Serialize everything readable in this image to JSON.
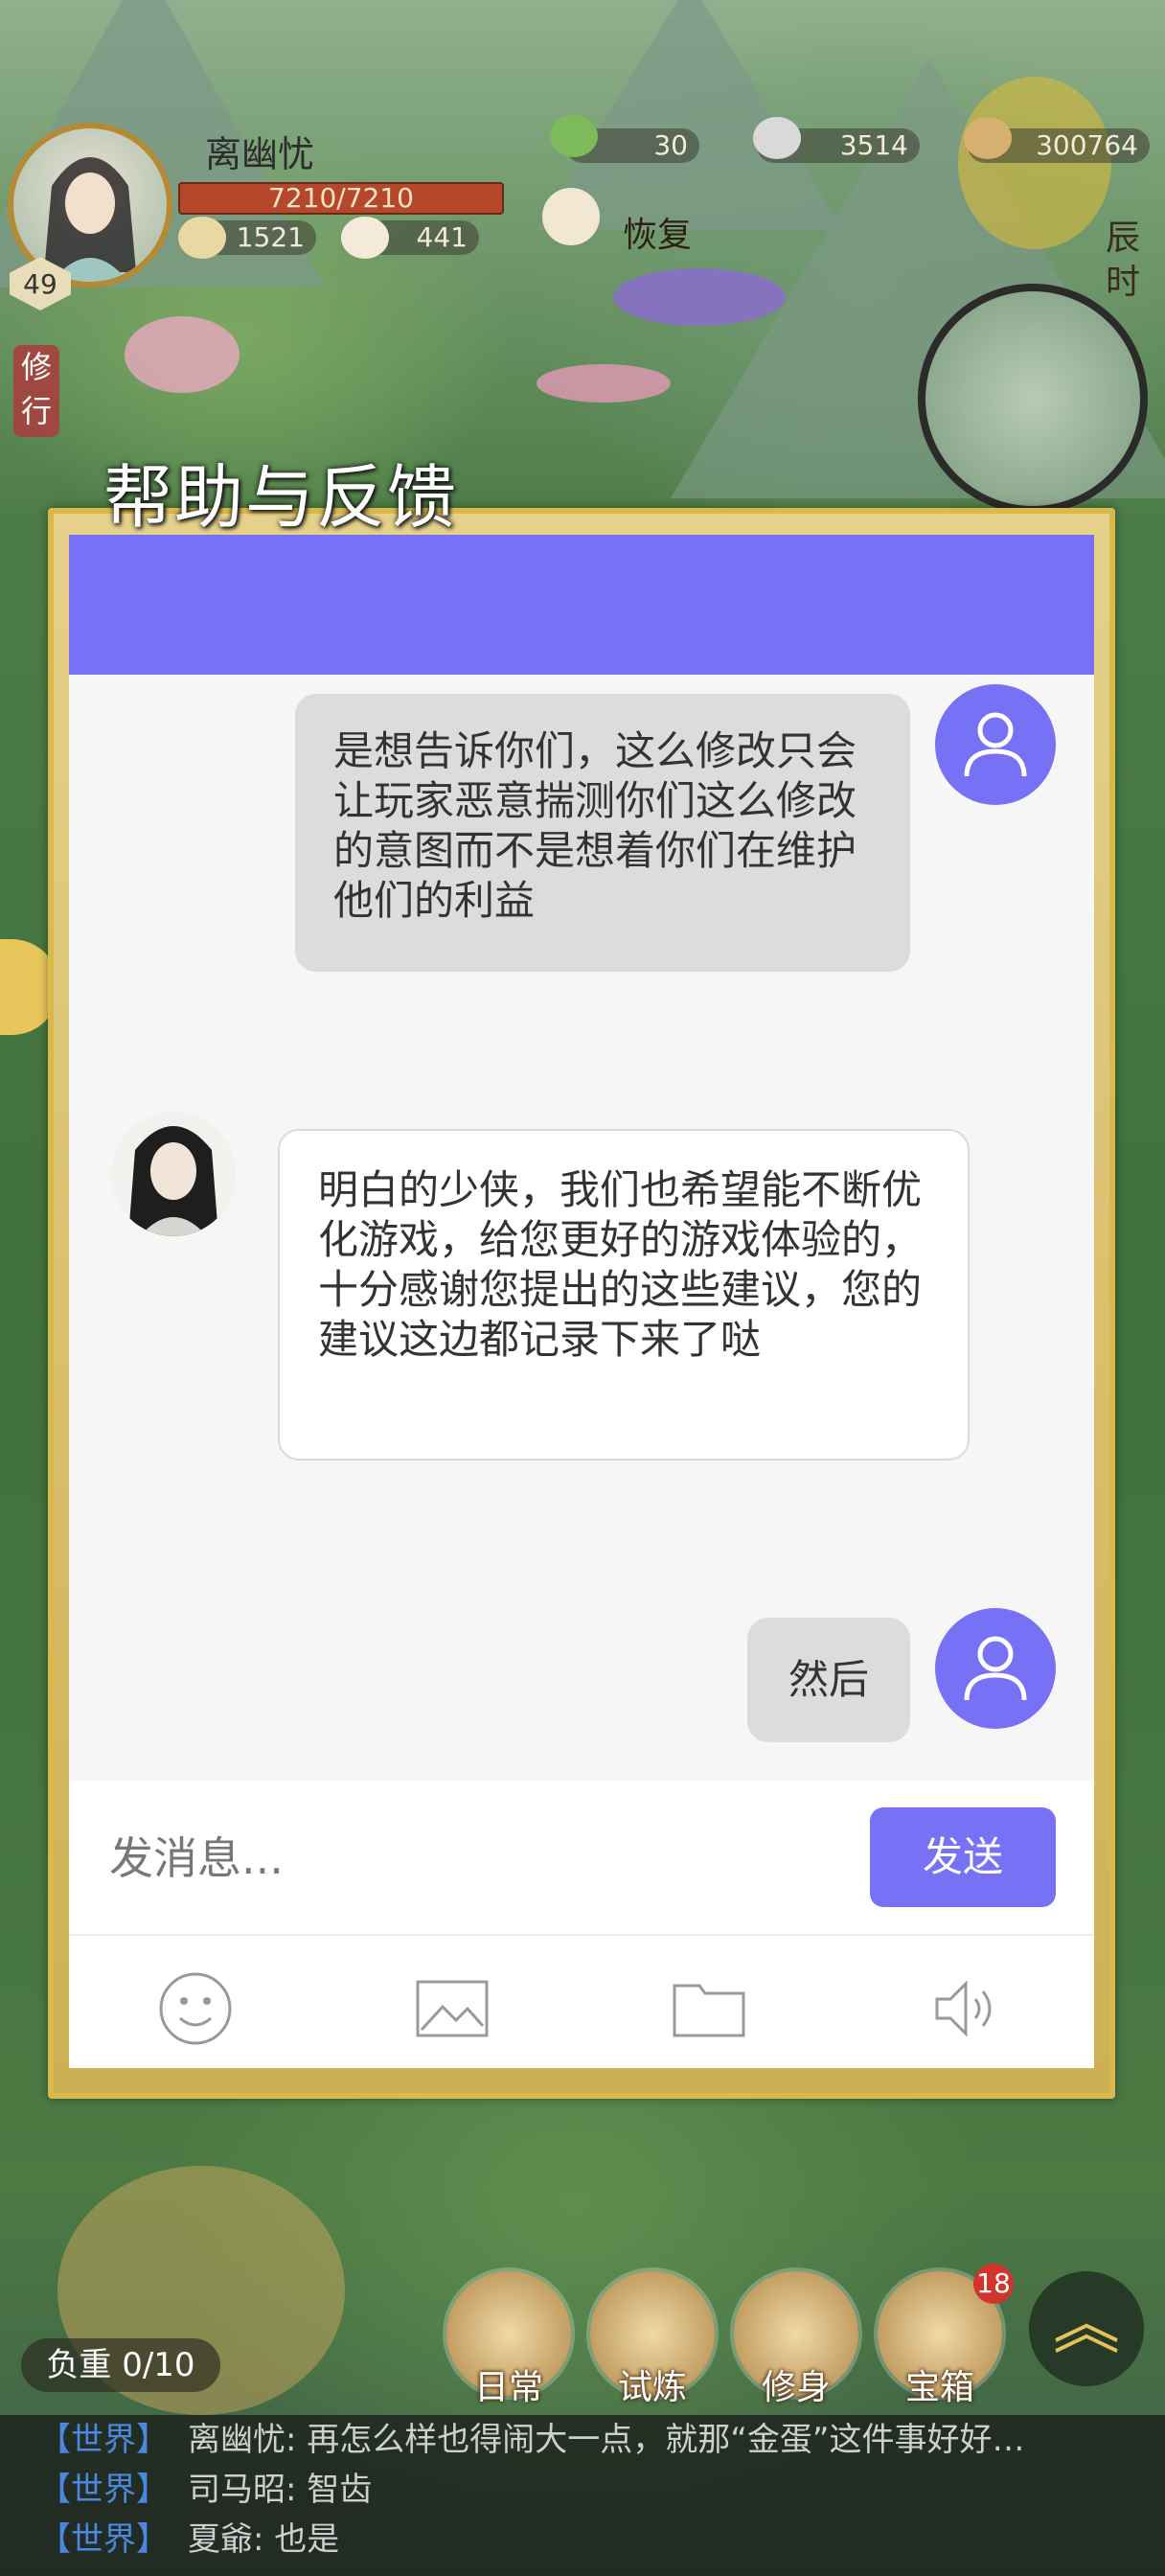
{
  "hud": {
    "player_name": "离幽忧",
    "level": "49",
    "hp": "7210/7210",
    "stat_a": "1521",
    "stat_b": "441",
    "currency_jade": "30",
    "currency_silver": "3514",
    "currency_coin": "300764",
    "recover_label": "恢复",
    "time_label": "辰时",
    "practice_label": "修行"
  },
  "dialog": {
    "title": "帮助与反馈",
    "messages": [
      {
        "sender": "user",
        "text": "是想告诉你们，这么修改只会让玩家恶意揣测你们这么修改的意图而不是想着你们在维护他们的利益"
      },
      {
        "sender": "agent",
        "text": "明白的少侠，我们也希望能不断优化游戏，给您更好的游戏体验的，十分感谢您提出的这些建议，您的建议这边都记录下来了哒"
      },
      {
        "sender": "user",
        "text": "然后"
      }
    ],
    "input_placeholder": "发消息...",
    "send_label": "发送",
    "accent_color": "#7771f5",
    "tools": [
      "emoji-icon",
      "image-icon",
      "folder-icon",
      "voice-icon"
    ]
  },
  "bottom": {
    "load_label": "负重 0/10",
    "menu": [
      {
        "label": "日常"
      },
      {
        "label": "试炼"
      },
      {
        "label": "修身"
      },
      {
        "label": "宝箱"
      }
    ],
    "badge": "18"
  },
  "world_chat": [
    {
      "tag": "【世界】",
      "text": "离幽忧: 再怎么样也得闹大一点，就那“金蛋”这件事好好…"
    },
    {
      "tag": "【世界】",
      "text": "司马昭: 智齿"
    },
    {
      "tag": "【世界】",
      "text": "夏爺: 也是"
    }
  ]
}
